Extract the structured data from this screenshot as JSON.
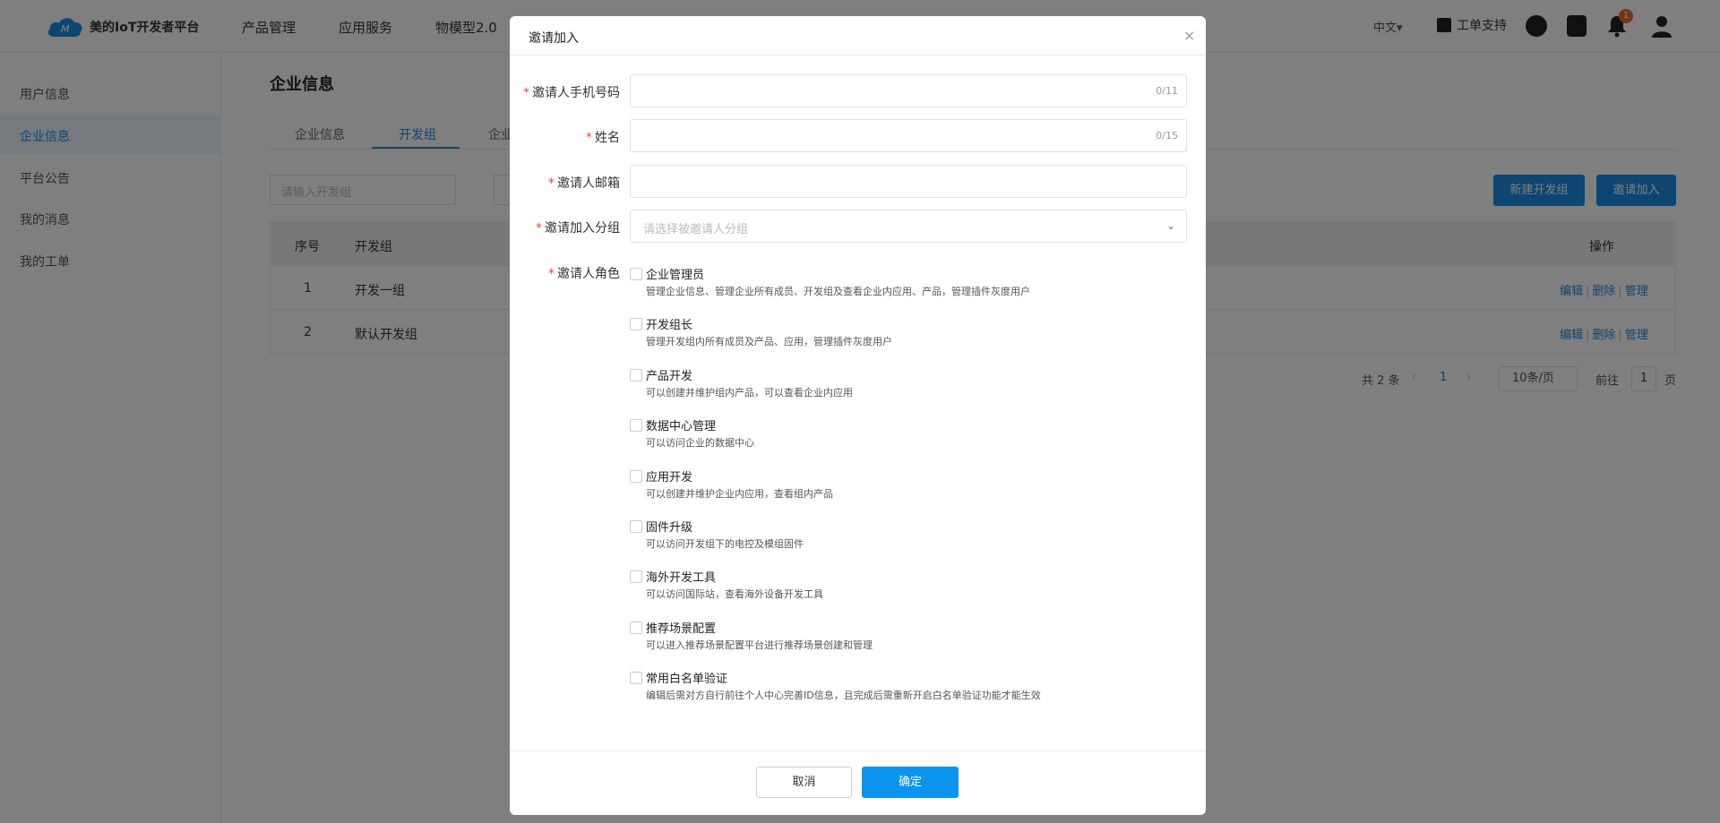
{
  "topbar": {
    "brand": "美的IoT开发者平台",
    "nav": [
      "产品管理",
      "应用服务",
      "物模型2.0"
    ],
    "lang": "中文▾",
    "ticket": "工单支持",
    "notification_count": "1"
  },
  "sidebar": {
    "items": [
      {
        "label": "用户信息"
      },
      {
        "label": "企业信息"
      },
      {
        "label": "平台公告"
      },
      {
        "label": "我的消息"
      },
      {
        "label": "我的工单"
      }
    ],
    "active_index": 1
  },
  "main": {
    "title": "企业信息",
    "tabs": [
      "企业信息",
      "开发组",
      "企业"
    ],
    "active_tab": 1,
    "search_placeholder": "请输入开发组",
    "btn_new": "新建开发组",
    "btn_invite": "邀请加入",
    "table": {
      "headers": [
        "序号",
        "开发组",
        "操作"
      ],
      "rows": [
        {
          "no": "1",
          "name": "开发一组"
        },
        {
          "no": "2",
          "name": "默认开发组"
        }
      ],
      "ops": [
        "编辑",
        "删除",
        "管理"
      ]
    },
    "pager": {
      "total": "共 2 条",
      "prev": "‹",
      "page": "1",
      "next": "›",
      "size": "10条/页",
      "goto_prefix": "前往",
      "goto_value": "1",
      "goto_suffix": "页"
    }
  },
  "modal": {
    "title": "邀请加入",
    "close": "×",
    "fields": {
      "phone": {
        "label": "邀请人手机号码",
        "counter": "0/11"
      },
      "name": {
        "label": "姓名",
        "counter": "0/15"
      },
      "email": {
        "label": "邀请人邮箱"
      },
      "group": {
        "label": "邀请加入分组",
        "placeholder": "请选择被邀请人分组"
      },
      "role": {
        "label": "邀请人角色"
      }
    },
    "roles": [
      {
        "title": "企业管理员",
        "desc": "管理企业信息、管理企业所有成员、开发组及查看企业内应用、产品，管理插件灰度用户"
      },
      {
        "title": "开发组长",
        "desc": "管理开发组内所有成员及产品、应用，管理插件灰度用户"
      },
      {
        "title": "产品开发",
        "desc": "可以创建并维护组内产品，可以查看企业内应用"
      },
      {
        "title": "数据中心管理",
        "desc": "可以访问企业的数据中心"
      },
      {
        "title": "应用开发",
        "desc": "可以创建并维护企业内应用，查看组内产品"
      },
      {
        "title": "固件升级",
        "desc": "可以访问开发组下的电控及模组固件"
      },
      {
        "title": "海外开发工具",
        "desc": "可以访问国际站，查看海外设备开发工具"
      },
      {
        "title": "推荐场景配置",
        "desc": "可以进入推荐场景配置平台进行推荐场景创建和管理"
      },
      {
        "title": "常用白名单验证",
        "desc": "编辑后需对方自行前往个人中心完善ID信息，且完成后需重新开启白名单验证功能才能生效"
      }
    ],
    "cancel": "取消",
    "ok": "确定"
  },
  "colors": {
    "accent": "#1a8ce2",
    "ok_button": "#0a94ee",
    "required": "#e84a3c",
    "badge": "#e86a2c"
  }
}
